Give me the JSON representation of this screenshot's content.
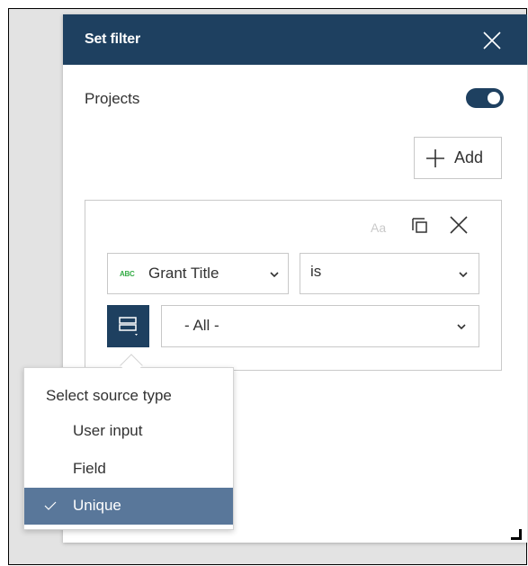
{
  "panel": {
    "title": "Set filter",
    "close_icon": "close-icon"
  },
  "filter": {
    "layer_label": "Projects",
    "toggle_on": true,
    "add_label": "Add"
  },
  "clause": {
    "case_sensitive_label": "Aa",
    "field_type_badge": "ABC",
    "field_value": "Grant Title",
    "operator_value": "is",
    "value_selection": "- All -"
  },
  "source_type_menu": {
    "title": "Select source type",
    "items": [
      {
        "label": "User input",
        "selected": false
      },
      {
        "label": "Field",
        "selected": false
      },
      {
        "label": "Unique",
        "selected": true
      }
    ]
  },
  "colors": {
    "header": "#1e4060",
    "accent": "#1e4060",
    "selected_item": "#59779a",
    "field_type_badge": "#35ac46"
  }
}
